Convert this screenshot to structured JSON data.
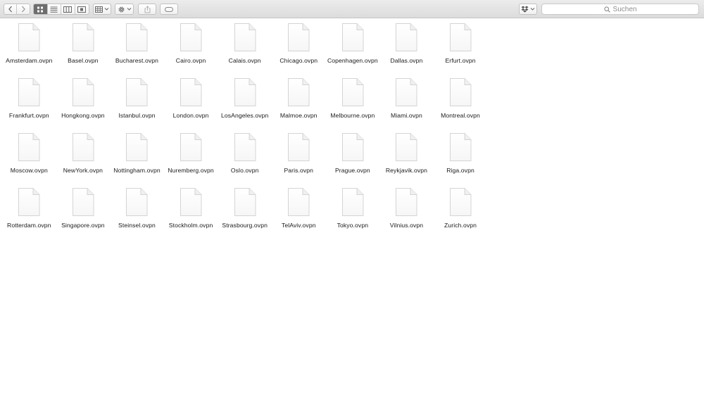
{
  "toolbar": {
    "back_icon": "chevron-left-icon",
    "forward_icon": "chevron-right-icon",
    "view_modes": [
      "icon-view-icon",
      "list-view-icon",
      "column-view-icon",
      "cover-flow-icon"
    ],
    "active_view": "icon-view-icon",
    "arrange_icon": "arrange-grid-icon",
    "action_icon": "gear-icon",
    "share_icon": "share-icon",
    "tags_icon": "tag-icon",
    "dropbox_icon": "dropbox-icon",
    "search_placeholder": "Suchen"
  },
  "files": [
    "Amsterdam.ovpn",
    "Basel.ovpn",
    "Bucharest.ovpn",
    "Cairo.ovpn",
    "Calais.ovpn",
    "Chicago.ovpn",
    "Copenhagen.ovpn",
    "Dallas.ovpn",
    "Erfurt.ovpn",
    "Frankfurt.ovpn",
    "Hongkong.ovpn",
    "Istanbul.ovpn",
    "London.ovpn",
    "LosAngeles.ovpn",
    "Malmoe.ovpn",
    "Melbourne.ovpn",
    "Miami.ovpn",
    "Montreal.ovpn",
    "Moscow.ovpn",
    "NewYork.ovpn",
    "Nottingham.ovpn",
    "Nuremberg.ovpn",
    "Oslo.ovpn",
    "Paris.ovpn",
    "Prague.ovpn",
    "Reykjavik.ovpn",
    "Riga.ovpn",
    "Rotterdam.ovpn",
    "Singapore.ovpn",
    "Steinsel.ovpn",
    "Stockholm.ovpn",
    "Strasbourg.ovpn",
    "TelAviv.ovpn",
    "Tokyo.ovpn",
    "Vilnius.ovpn",
    "Zurich.ovpn"
  ]
}
